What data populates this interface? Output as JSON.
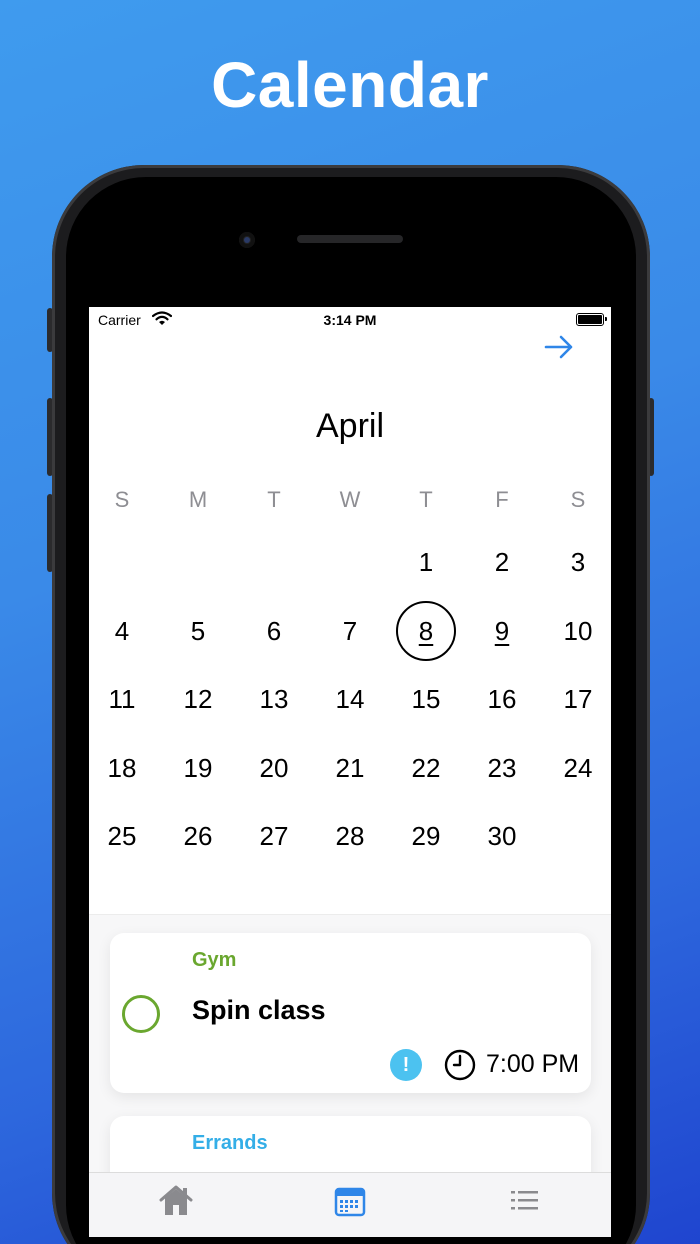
{
  "headline": "Calendar",
  "status": {
    "carrier": "Carrier",
    "time": "3:14 PM"
  },
  "calendar": {
    "month": "April",
    "weekdays": [
      "S",
      "M",
      "T",
      "W",
      "T",
      "F",
      "S"
    ],
    "days": [
      [
        "",
        "",
        "",
        "",
        "1",
        "2",
        "3"
      ],
      [
        "4",
        "5",
        "6",
        "7",
        "8",
        "9",
        "10"
      ],
      [
        "11",
        "12",
        "13",
        "14",
        "15",
        "16",
        "17"
      ],
      [
        "18",
        "19",
        "20",
        "21",
        "22",
        "23",
        "24"
      ],
      [
        "25",
        "26",
        "27",
        "28",
        "29",
        "30",
        ""
      ]
    ],
    "selected_day": "8",
    "marked_day": "9"
  },
  "tasks": [
    {
      "category": "Gym",
      "title": "Spin class",
      "priority_icon": "!",
      "time": "7:00 PM"
    },
    {
      "category": "Errands"
    }
  ],
  "colors": {
    "accent": "#2f86e8",
    "gym": "#6aa72f",
    "errands": "#34aee7",
    "priority": "#4cc2f0"
  },
  "tabs": [
    {
      "icon": "home-icon"
    },
    {
      "icon": "calendar-icon"
    },
    {
      "icon": "list-icon"
    }
  ]
}
